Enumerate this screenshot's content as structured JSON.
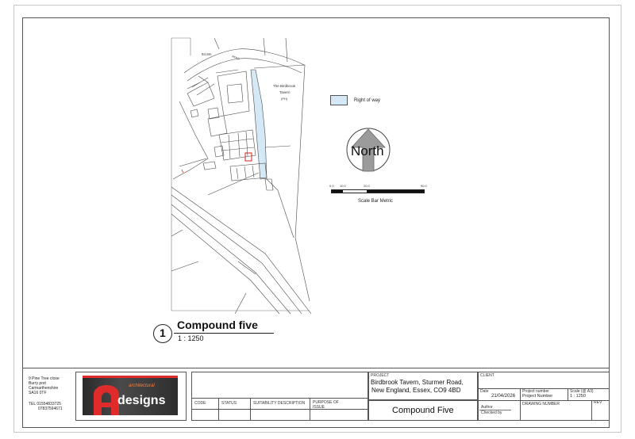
{
  "map": {
    "labels": {
      "bm": "94.8m",
      "road": "ROAD",
      "pub_name": "The Birdbrook",
      "pub_name2": "Tavern",
      "pub_ph": "(PH)"
    }
  },
  "legend": {
    "label": "Right of way",
    "swatch_color": "#d4e8f6"
  },
  "north_arrow": {
    "label": "North"
  },
  "scale_bar": {
    "ticks": [
      "0.0",
      "10.0",
      "20.0",
      "90.0"
    ],
    "caption": "Scale Bar Metric"
  },
  "view_title": {
    "number": "1",
    "title": "Compound five",
    "scale": "1 : 1250"
  },
  "title_block": {
    "address": [
      "9 Pine Tree close",
      "Burry port",
      "Carmarthenshire",
      "SA16 0TF"
    ],
    "tel": "TEL 01554833725",
    "mobile": "07837594671",
    "logo": {
      "letter": "A",
      "small": "architectural",
      "word": "designs",
      "accent_color": "#e02b2b"
    },
    "revision_headers": {
      "code": "CODE",
      "status": "STATUS",
      "suitability": "SUITABILITY DESCRIPTION",
      "purpose": "PURPOSE OF",
      "purpose2": "ISSUE"
    },
    "project_label": "PROJECT",
    "project_lines": [
      "Birdbrook Tavern, Sturmer Road,",
      "New England, Essex, CO9 4BD"
    ],
    "drawing_title": "Compound Five",
    "client_label": "CLIENT",
    "date_label": "Date",
    "date_value": "21/04/2026",
    "project_number_label": "Project number",
    "project_number_value": "Project Number",
    "scale_label": "Scale (@ A3)",
    "scale_value": "1 : 1250",
    "author_label": "Author",
    "checked_label": "Checked by",
    "drawing_number_label": "DRAWING NUMBER",
    "rev_label": "REV"
  }
}
